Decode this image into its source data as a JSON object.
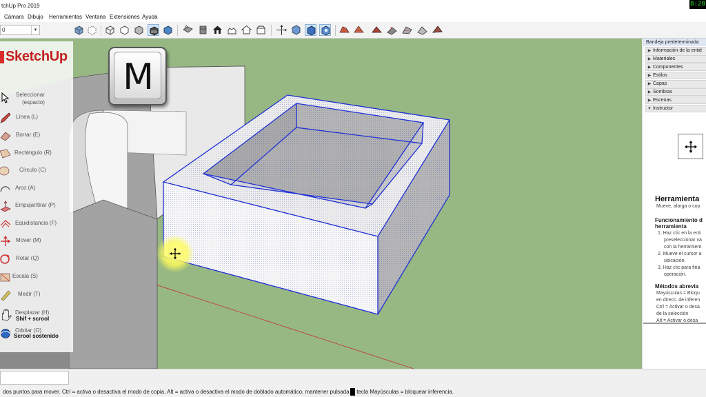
{
  "window": {
    "title": "tchUp Pro 2019",
    "clock": "8:28"
  },
  "menu": [
    "Cámara",
    "Dibujo",
    "Herramientas",
    "Ventana",
    "Extensiones",
    "Ayuda"
  ],
  "toolbar": {
    "combo_value": "0"
  },
  "overlay": {
    "logo": "SketchUp",
    "key": "M",
    "tools": [
      {
        "label": "Seleccionar",
        "sub_label": "(espacio)",
        "icon": "select-arrow-icon"
      },
      {
        "label": "Línea (L)",
        "icon": "pencil-icon"
      },
      {
        "label": "Borrar (E)",
        "icon": "eraser-icon"
      },
      {
        "label": "Rectángulo (R)",
        "icon": "rectangle-icon"
      },
      {
        "label": "Círculo (C)",
        "icon": "circle-icon"
      },
      {
        "label": "Arco (A)",
        "icon": "arc-icon"
      },
      {
        "label": "Empujar/tirar (P)",
        "icon": "push-pull-icon"
      },
      {
        "label": "Equidistancia (F)",
        "icon": "offset-icon"
      },
      {
        "label": "Mover (M)",
        "icon": "move-icon"
      },
      {
        "label": "Rotar (Q)",
        "icon": "rotate-icon"
      },
      {
        "label": "Escala (S)",
        "icon": "scale-icon"
      },
      {
        "label": "Medir (T)",
        "icon": "tape-measure-icon"
      },
      {
        "label": "Desplazar (H)",
        "sub_label": "Shif + scrool",
        "icon": "pan-icon"
      },
      {
        "label": "Orbitar (O)",
        "sub_label": "Scrool sostenido",
        "icon": "orbit-icon"
      }
    ]
  },
  "tray": {
    "title": "Bandeja predeterminada",
    "panels": [
      {
        "label": "Información de la entid",
        "expanded": false
      },
      {
        "label": "Materiales",
        "expanded": false
      },
      {
        "label": "Componentes",
        "expanded": false
      },
      {
        "label": "Estilos",
        "expanded": false
      },
      {
        "label": "Capas",
        "expanded": false
      },
      {
        "label": "Sombras",
        "expanded": false
      },
      {
        "label": "Escenas",
        "expanded": false
      },
      {
        "label": "Instructor",
        "expanded": true
      }
    ],
    "instructor": {
      "tool_title": "Herramienta",
      "summary": "Mueve, alarga o cop",
      "section1_line1": "Funcionamiento d",
      "section1_line2": "herramienta",
      "steps": [
        "1. Haz clic en la enti",
        "preseleccionar va",
        "con la herramient",
        "2. Mueve el cursor a",
        "ubicación.",
        "3. Haz clic para fina",
        "operación."
      ],
      "section2": "Métodos abrevia",
      "shortcuts": [
        "Mayúsculas = Bloqu",
        "en direcc. de inferen",
        "Ctrl = Activar o desa",
        "de la selección",
        "Alt = Activar o desa"
      ]
    }
  },
  "status": {
    "text": "dos puntos para mover. Ctrl = activa o desactiva el modo de copia, Alt = activa o desactiva el modo de doblado automático, mantener pulsada la tecla Mayúsculas = bloquear inferencia."
  },
  "colors": {
    "sky_ground": "#97b883",
    "selection_edge": "#1e2fd6",
    "logo_red": "#c32020",
    "cursor_glow": "#fff766",
    "clock_text": "#24e024"
  }
}
